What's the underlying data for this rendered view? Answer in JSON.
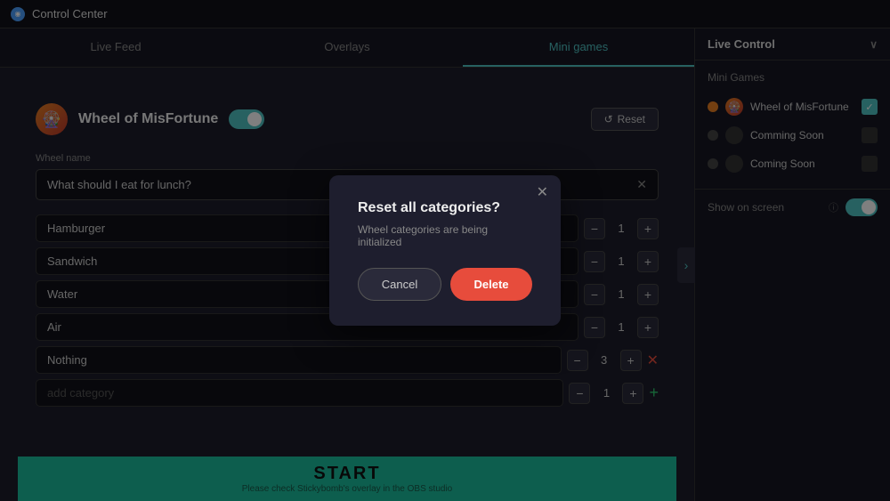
{
  "topbar": {
    "icon": "◉",
    "title": "Control Center"
  },
  "tabs": [
    {
      "id": "live-feed",
      "label": "Live Feed",
      "active": false
    },
    {
      "id": "overlays",
      "label": "Overlays",
      "active": false
    },
    {
      "id": "mini-games",
      "label": "Mini games",
      "active": true
    }
  ],
  "game": {
    "icon": "🎡",
    "title": "Wheel of MisFortune",
    "toggle_state": "on",
    "reset_label": "Reset"
  },
  "wheel_name": {
    "label": "Wheel name",
    "value": "What should I eat for lunch?"
  },
  "categories": [
    {
      "name": "Hamburger",
      "qty": 1,
      "has_delete": false
    },
    {
      "name": "Sandwich",
      "qty": 1,
      "has_delete": false
    },
    {
      "name": "Water",
      "qty": 1,
      "has_delete": false
    },
    {
      "name": "Air",
      "qty": 1,
      "has_delete": false
    },
    {
      "name": "Nothing",
      "qty": 3,
      "has_delete": true
    },
    {
      "name": "",
      "qty": 1,
      "has_delete": false,
      "placeholder": "add category"
    }
  ],
  "start_bar": {
    "label": "START",
    "subtitle": "Please check Stickybomb's overlay in the OBS studio"
  },
  "right_panel": {
    "title": "Live Control",
    "section_title": "Mini Games",
    "games": [
      {
        "name": "Wheel of MisFortune",
        "active": true,
        "checked": true
      },
      {
        "name": "Comming Soon",
        "active": false,
        "checked": false
      },
      {
        "name": "Coming Soon",
        "active": false,
        "checked": false
      }
    ],
    "show_on_screen_label": "Show on screen",
    "show_on_screen_state": "on"
  },
  "modal": {
    "title": "Reset all categories?",
    "subtitle": "Wheel categories are being initialized",
    "cancel_label": "Cancel",
    "delete_label": "Delete",
    "close_icon": "✕"
  },
  "icons": {
    "reset": "↺",
    "chevron_down": "∨",
    "right_arrow": "›",
    "minus": "−",
    "plus": "+"
  }
}
